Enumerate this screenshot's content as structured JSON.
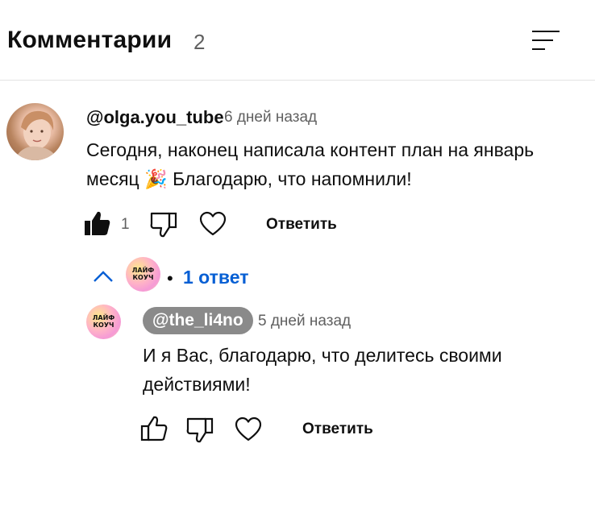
{
  "header": {
    "title": "Комментарии",
    "count": "2",
    "sort_icon": "sort-icon"
  },
  "comment": {
    "author": "@olga.you_tube",
    "time": "6 дней назад",
    "text_line1": "Сегодня, наконец написала контент план на январь",
    "text_line2_a": "месяц",
    "emoji": "🎉",
    "text_line2_b": "Благодарю, что напомнили!",
    "like_count": "1",
    "reply_label": "Ответить",
    "liked": true
  },
  "replies_toggle": {
    "label": "1 ответ",
    "separator": "•",
    "icon": "chevron-up-icon"
  },
  "reply": {
    "author": "@the_li4no",
    "time": "5 дней назад",
    "text_line1": "И я Вас, благодарю, что делитесь своими",
    "text_line2": "действиями!",
    "reply_label": "Ответить"
  },
  "logo_text": {
    "line1": "ЛАЙФ",
    "line2": "КОУЧ"
  },
  "colors": {
    "link": "#065fd4",
    "chip": "#8a8a8a",
    "divider": "#e3e3e3"
  }
}
